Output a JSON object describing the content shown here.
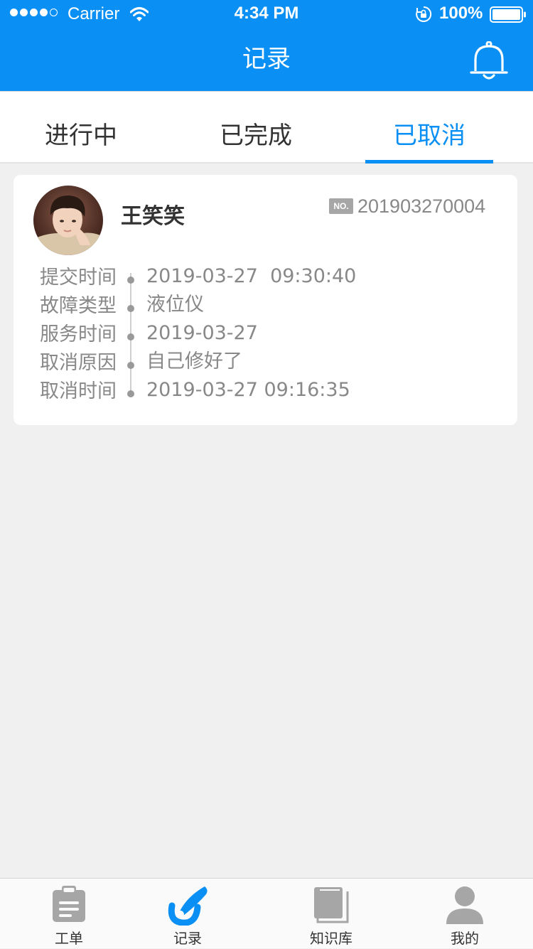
{
  "status_bar": {
    "carrier": "Carrier",
    "time": "4:34 PM",
    "battery": "100%"
  },
  "nav": {
    "title": "记录",
    "bell_icon": "bell-icon"
  },
  "tabs": [
    {
      "label": "进行中",
      "active": false
    },
    {
      "label": "已完成",
      "active": false
    },
    {
      "label": "已取消",
      "active": true
    }
  ],
  "record": {
    "name": "王笑笑",
    "no_badge": "NO.",
    "order_no": "201903270004",
    "fields": [
      {
        "label": "提交时间",
        "value": "2019-03-27  09:30:40"
      },
      {
        "label": "故障类型",
        "value": "液位仪"
      },
      {
        "label": "服务时间",
        "value": "2019-03-27"
      },
      {
        "label": "取消原因",
        "value": "自己修好了"
      },
      {
        "label": "取消时间",
        "value": "2019-03-27 09:16:35"
      }
    ]
  },
  "tabbar": [
    {
      "label": "工单",
      "icon": "clipboard-icon",
      "active": false
    },
    {
      "label": "记录",
      "icon": "record-icon",
      "active": true
    },
    {
      "label": "知识库",
      "icon": "book-icon",
      "active": false
    },
    {
      "label": "我的",
      "icon": "person-icon",
      "active": false
    }
  ],
  "colors": {
    "primary": "#0a8ff5",
    "inactive_icon": "#a6a6a6",
    "background": "#f0f0f0"
  }
}
